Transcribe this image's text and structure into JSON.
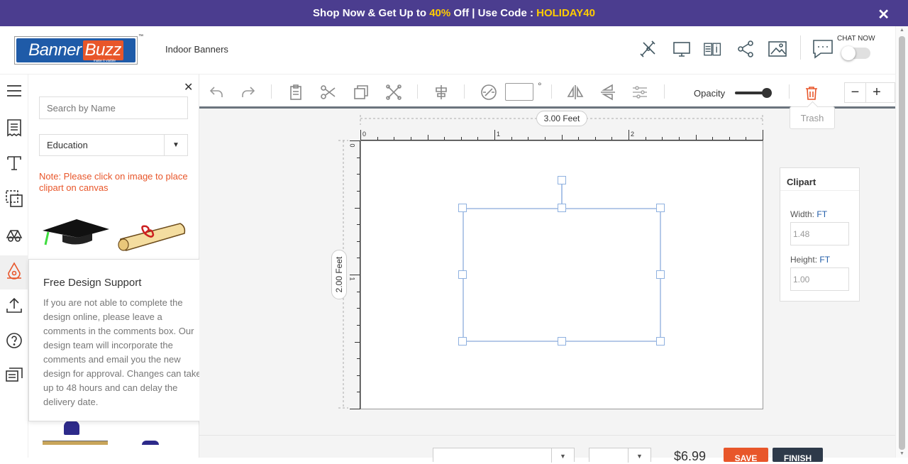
{
  "promo": {
    "text_prefix": "Shop Now & Get Up to ",
    "discount": "40%",
    "text_middle": " Off | Use Code : ",
    "code": "HOLIDAY40",
    "close": "✕"
  },
  "header": {
    "logo_banner": "Banner",
    "logo_buzz": "Buzz",
    "logo_tagline": "make it visible",
    "logo_tm": "™",
    "breadcrumb": "Indoor Banners",
    "icons": [
      "design-tools-icon",
      "preview-icon",
      "specs-icon",
      "share-icon",
      "image-icon",
      "chat-icon"
    ],
    "chat_label": "CHAT NOW"
  },
  "sidebar": {
    "icons": [
      "menu-icon",
      "templates-icon",
      "text-icon",
      "shapes-icon",
      "backgrounds-icon",
      "clipart-icon",
      "upload-icon",
      "help-icon",
      "comments-icon"
    ],
    "active": "clipart-icon"
  },
  "clipart_panel": {
    "close": "✕",
    "search_placeholder": "Search by Name",
    "category": "Education",
    "note": "Note: Please click on image to place clipart on canvas"
  },
  "support_popup": {
    "title": "Free Design Support",
    "body": "If you are not able to complete the design online, please leave a comments in the comments box. Our design team will incorporate the comments and email you the new design for approval. Changes can take up to 48 hours and can delay the delivery date.",
    "close": "✕"
  },
  "toolbar": {
    "rotation_unit": "°",
    "opacity_label": "Opacity",
    "opacity_value": 0.9,
    "zoom_out": "−",
    "zoom_in": "+",
    "trash_tooltip": "Trash"
  },
  "canvas": {
    "width_label": "3.00 Feet",
    "height_label": "2.00 Feet",
    "hruler_ticks": [
      "0",
      "1",
      "2"
    ],
    "vruler_ticks": [
      "0",
      "1"
    ]
  },
  "clip_props": {
    "title": "Clipart",
    "width_label": "Width:",
    "width_unit": "FT",
    "width_value": "1.48",
    "height_label": "Height:",
    "height_unit": "FT",
    "height_value": "1.00"
  },
  "footer": {
    "price": "$6.99",
    "save": "SAVE",
    "finish": "FINISH"
  }
}
